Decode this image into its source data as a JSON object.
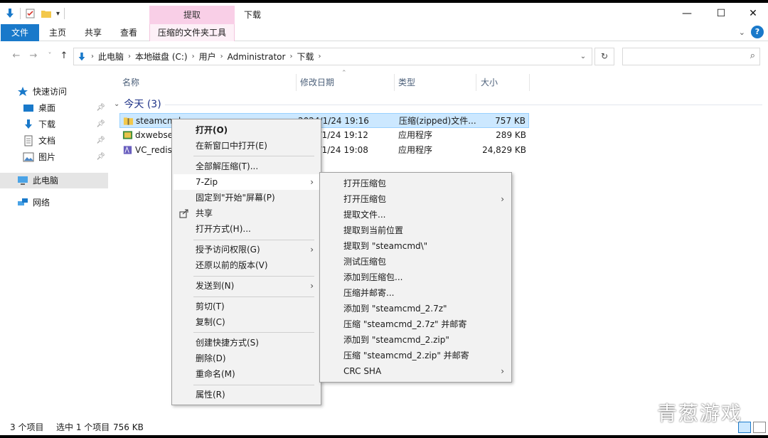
{
  "window": {
    "title": "下载",
    "context_tab_head": "提取",
    "controls": {
      "minimize": "—",
      "maximize": "☐",
      "close": "✕"
    }
  },
  "ribbon": {
    "tabs": [
      "文件",
      "主页",
      "共享",
      "查看",
      "压缩的文件夹工具"
    ],
    "accent": "#1979ca",
    "help": "?"
  },
  "nav": {
    "back": "←",
    "forward": "→",
    "recent": "˅",
    "up": "↑",
    "breadcrumbs": [
      "此电脑",
      "本地磁盘 (C:)",
      "用户",
      "Administrator",
      "下载"
    ],
    "refresh": "↻",
    "search_placeholder": ""
  },
  "sidebar": {
    "items": [
      {
        "label": "快速访问",
        "icon": "star-icon",
        "pinned": false
      },
      {
        "label": "桌面",
        "icon": "desktop-icon",
        "pinned": true
      },
      {
        "label": "下载",
        "icon": "download-icon",
        "pinned": true
      },
      {
        "label": "文档",
        "icon": "document-icon",
        "pinned": true
      },
      {
        "label": "图片",
        "icon": "picture-icon",
        "pinned": true
      },
      {
        "label": "此电脑",
        "icon": "computer-icon",
        "pinned": false
      },
      {
        "label": "网络",
        "icon": "network-icon",
        "pinned": false
      }
    ]
  },
  "columns": {
    "name": "名称",
    "date": "修改日期",
    "type": "类型",
    "size": "大小"
  },
  "group": {
    "label": "今天 (3)"
  },
  "files": [
    {
      "name": "steamcmd",
      "date": "2024/1/24 19:16",
      "type": "压缩(zipped)文件...",
      "size": "757 KB"
    },
    {
      "name": "dxwebse",
      "date": "2024/1/24 19:12",
      "type": "应用程序",
      "size": "289 KB"
    },
    {
      "name": "VC_redist",
      "date": "2024/1/24 19:08",
      "type": "应用程序",
      "size": "24,829 KB"
    }
  ],
  "status": {
    "count": "3 个项目",
    "selected": "选中 1 个项目",
    "size": "756 KB"
  },
  "context_menu": {
    "items": [
      "打开(O)",
      "在新窗口中打开(E)",
      "全部解压缩(T)...",
      "7-Zip",
      "固定到\"开始\"屏幕(P)",
      "共享",
      "打开方式(H)...",
      "授予访问权限(G)",
      "还原以前的版本(V)",
      "发送到(N)",
      "剪切(T)",
      "复制(C)",
      "创建快捷方式(S)",
      "删除(D)",
      "重命名(M)",
      "属性(R)"
    ]
  },
  "submenu": {
    "items": [
      "打开压缩包",
      "打开压缩包",
      "提取文件...",
      "提取到当前位置",
      "提取到 \"steamcmd\\\"",
      "测试压缩包",
      "添加到压缩包...",
      "压缩并邮寄...",
      "添加到 \"steamcmd_2.7z\"",
      "压缩 \"steamcmd_2.7z\" 并邮寄",
      "添加到 \"steamcmd_2.zip\"",
      "压缩 \"steamcmd_2.zip\" 并邮寄",
      "CRC SHA"
    ]
  },
  "watermark": "青葱游戏"
}
